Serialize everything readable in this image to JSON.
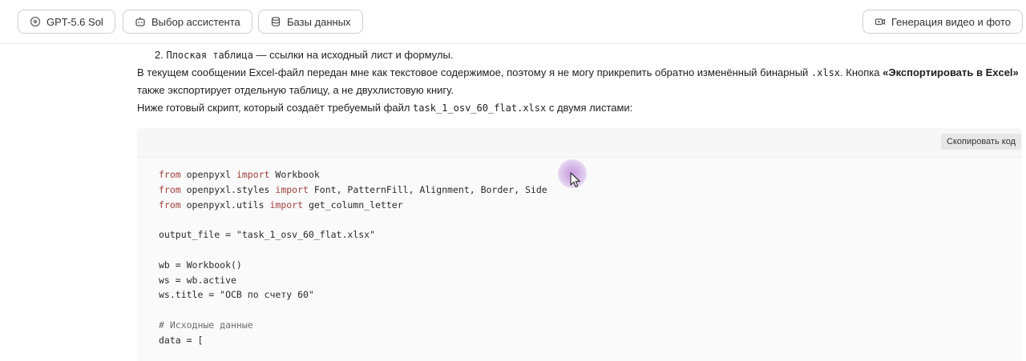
{
  "toolbar": {
    "model_label": "GPT-5.6 Sol",
    "assistant_label": "Выбор ассистента",
    "databases_label": "Базы данных",
    "media_label": "Генерация видео и фото"
  },
  "message": {
    "list_item_number": "2.",
    "list_item_code": "Плоская таблица",
    "list_item_text": " — ссылки на исходный лист и формулы.",
    "para1_part1": "В текущем сообщении Excel-файл передан мне как текстовое содержимое, поэтому я не могу прикрепить обратно изменённый бинарный ",
    "para1_code": ".xlsx",
    "para1_part2": ". Кнопка ",
    "para1_bold": "«Экспортировать в Excel»",
    "para1_part3": " также экспортирует отдельную таблицу, а не двухлистовую книгу.",
    "para2_part1": "Ниже готовый скрипт, который создаёт требуемый файл ",
    "para2_code": "task_1_osv_60_flat.xlsx",
    "para2_part2": " с двумя листами:"
  },
  "code_block": {
    "copy_label": "Скопировать код",
    "lines": [
      [
        {
          "k": "kw",
          "t": "from"
        },
        {
          "k": "",
          "t": " openpyxl "
        },
        {
          "k": "kw",
          "t": "import"
        },
        {
          "k": "",
          "t": " Workbook"
        }
      ],
      [
        {
          "k": "kw",
          "t": "from"
        },
        {
          "k": "",
          "t": " openpyxl.styles "
        },
        {
          "k": "kw",
          "t": "import"
        },
        {
          "k": "",
          "t": " Font, PatternFill, Alignment, Border, Side"
        }
      ],
      [
        {
          "k": "kw",
          "t": "from"
        },
        {
          "k": "",
          "t": " openpyxl.utils "
        },
        {
          "k": "kw",
          "t": "import"
        },
        {
          "k": "",
          "t": " get_column_letter"
        }
      ],
      [],
      [
        {
          "k": "",
          "t": "output_file = \"task_1_osv_60_flat.xlsx\""
        }
      ],
      [],
      [
        {
          "k": "",
          "t": "wb = Workbook()"
        }
      ],
      [
        {
          "k": "",
          "t": "ws = wb.active"
        }
      ],
      [
        {
          "k": "",
          "t": "ws.title = \"ОСВ по счету 60\""
        }
      ],
      [],
      [
        {
          "k": "cm",
          "t": "# Исходные данные"
        }
      ],
      [
        {
          "k": "",
          "t": "data = ["
        }
      ]
    ]
  }
}
